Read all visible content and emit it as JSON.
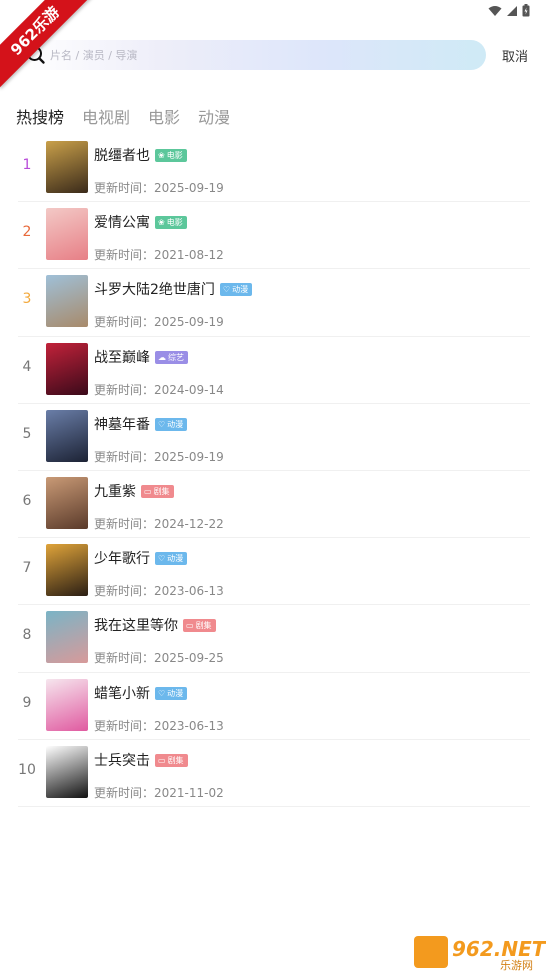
{
  "ribbon": {
    "text": "962乐游"
  },
  "search": {
    "placeholder": "片名 / 演员 / 导演",
    "cancel_label": "取消"
  },
  "tabs": [
    {
      "label": "热搜榜",
      "active": true
    },
    {
      "label": "电视剧",
      "active": false
    },
    {
      "label": "电影",
      "active": false
    },
    {
      "label": "动漫",
      "active": false
    }
  ],
  "update_prefix": "更新时间：",
  "tag_colors": {
    "电影": "#5cc79b",
    "动漫": "#6cb8ec",
    "综艺": "#9a8ee6",
    "剧集": "#f08a8e"
  },
  "rank_colors": {
    "1": "#b84bd8",
    "2": "#e86a3b",
    "3": "#f3a93c",
    "default": "#777777"
  },
  "items": [
    {
      "rank": "1",
      "title": "脱缰者也",
      "tag": "电影",
      "date": "2025-09-19",
      "poster_colors": [
        "#c9a04a",
        "#3a2a1a"
      ]
    },
    {
      "rank": "2",
      "title": "爱情公寓",
      "tag": "电影",
      "date": "2021-08-12",
      "poster_colors": [
        "#f3c9c6",
        "#e77f86"
      ]
    },
    {
      "rank": "3",
      "title": "斗罗大陆2绝世唐门",
      "tag": "动漫",
      "date": "2025-09-19",
      "poster_colors": [
        "#9fc0d8",
        "#a88a6a"
      ]
    },
    {
      "rank": "4",
      "title": "战至巅峰",
      "tag": "综艺",
      "date": "2024-09-14",
      "poster_colors": [
        "#c2223a",
        "#3a0a1a"
      ]
    },
    {
      "rank": "5",
      "title": "神墓年番",
      "tag": "动漫",
      "date": "2025-09-19",
      "poster_colors": [
        "#6a7ea8",
        "#1c2234"
      ]
    },
    {
      "rank": "6",
      "title": "九重紫",
      "tag": "剧集",
      "date": "2024-12-22",
      "poster_colors": [
        "#c99a76",
        "#5a3a2a"
      ]
    },
    {
      "rank": "7",
      "title": "少年歌行",
      "tag": "动漫",
      "date": "2023-06-13",
      "poster_colors": [
        "#e0a43a",
        "#2a1e14"
      ]
    },
    {
      "rank": "8",
      "title": "我在这里等你",
      "tag": "剧集",
      "date": "2025-09-25",
      "poster_colors": [
        "#7ab4c6",
        "#d89a9a"
      ]
    },
    {
      "rank": "9",
      "title": "蜡笔小新",
      "tag": "动漫",
      "date": "2023-06-13",
      "poster_colors": [
        "#f6e6ee",
        "#e05aa0"
      ]
    },
    {
      "rank": "10",
      "title": "士兵突击",
      "tag": "剧集",
      "date": "2021-11-02",
      "poster_colors": [
        "#ffffff",
        "#111111"
      ]
    }
  ],
  "watermark": {
    "text": "962.NET",
    "subtext": "乐游网"
  }
}
